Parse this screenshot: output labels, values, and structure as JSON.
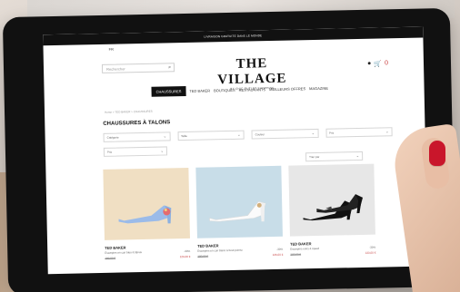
{
  "site": {
    "topbar_text": "LIVRAISON GRATUITE DANS LE MONDE",
    "language_label": "FR",
    "search_placeholder": "Rechercher",
    "search_icon": "search-icon",
    "logo_main": "THE VILLAGE",
    "logo_sub": "BY CHIC OUTLET SHOPPING",
    "nav_items": [
      "CHAUSSURES",
      "TED BAKER",
      "BOUTIQUES",
      "RESTAURANTS",
      "MEILLEURS OFFRES",
      "MAGAZINE"
    ],
    "breadcrumb": "Home > TED BAKER > CHAUSSURES",
    "page_title": "CHAUSSURES À TALONS",
    "filters": [
      "Catégorie",
      "Taille",
      "Couleur",
      "Prix"
    ],
    "filter_secondary": "Prix",
    "sort_label": "Trier par",
    "colors": {
      "accent_red": "#c74444",
      "dark": "#111111"
    }
  },
  "products": [
    {
      "brand": "TED BAKER",
      "description": "Escarpins en cuir bleu à bijoux",
      "discount": "-30%",
      "old_price": "180,00 €",
      "new_price": "126,00 €"
    },
    {
      "brand": "TED BAKER",
      "description": "Escarpins en cuir blanc à bout pointu",
      "discount": "-30%",
      "old_price": "180,00 €",
      "new_price": "126,00 €"
    },
    {
      "brand": "TED BAKER",
      "description": "Escarpins noirs à nœud",
      "discount": "-30%",
      "old_price": "190,00 €",
      "new_price": "133,00 €"
    }
  ]
}
